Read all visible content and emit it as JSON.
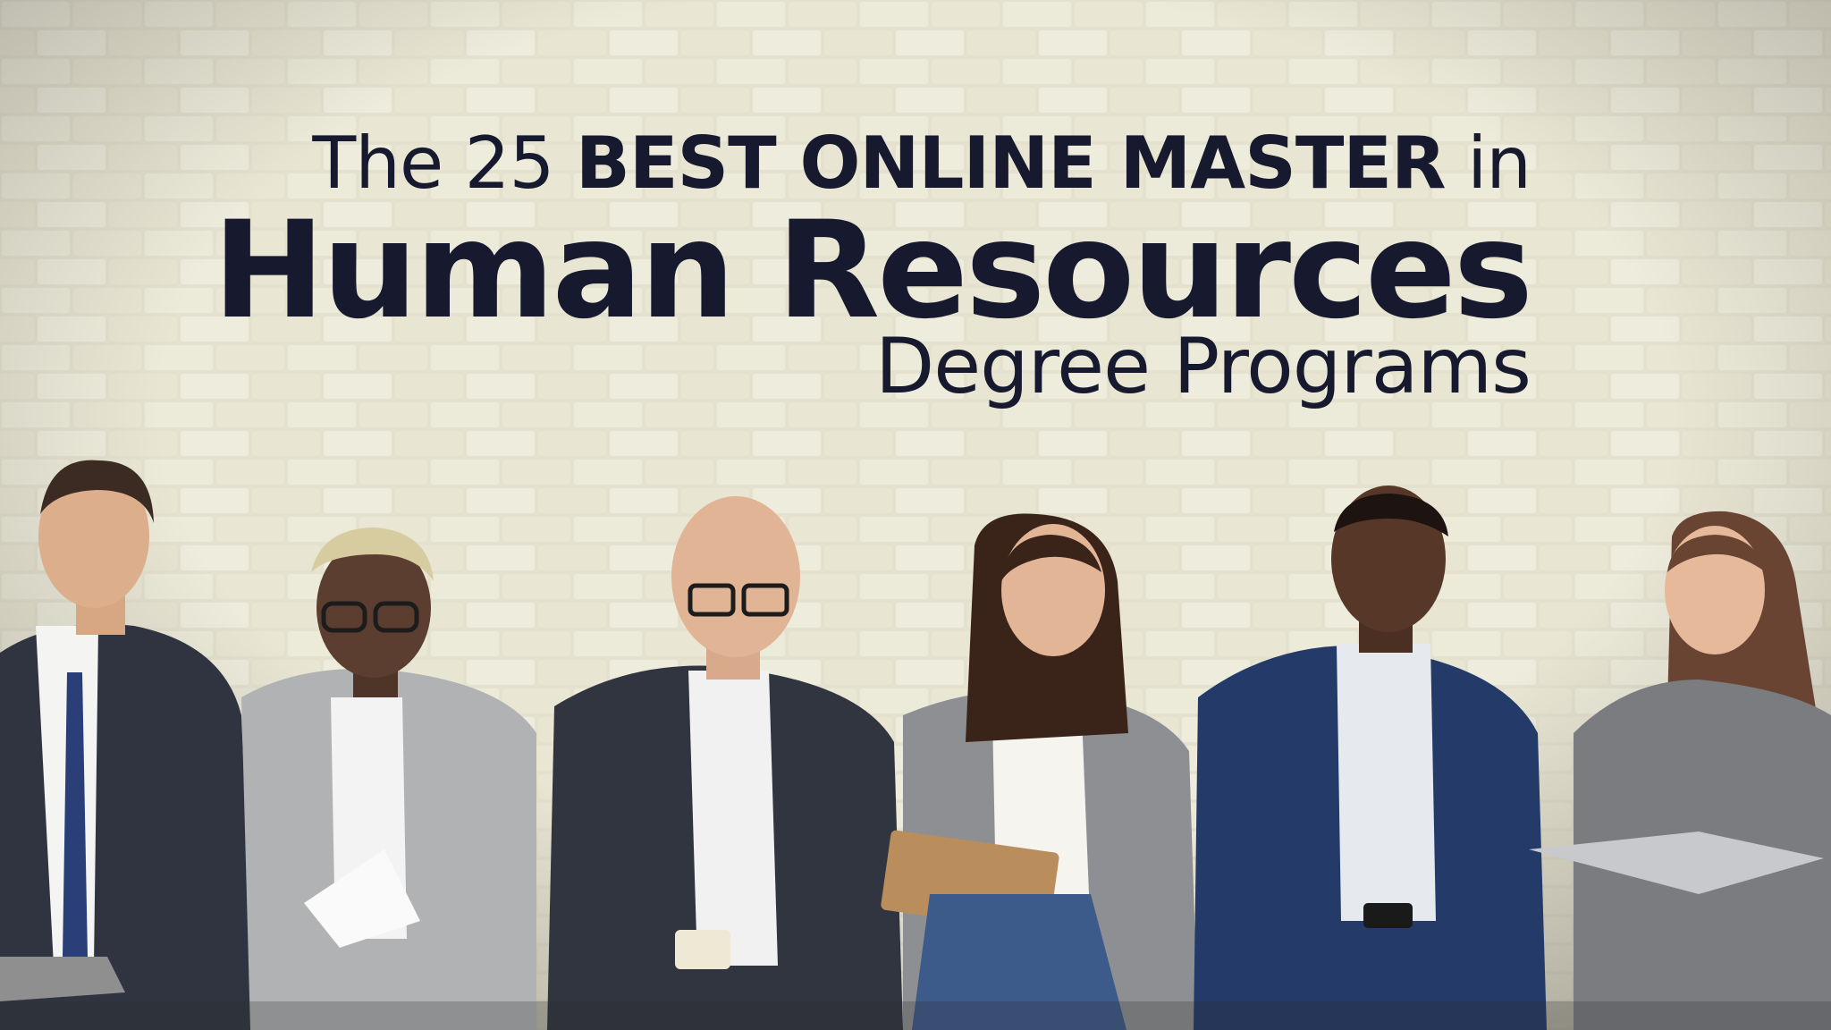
{
  "headline": {
    "line1_prefix": "The 25 ",
    "line1_bold": "BEST ONLINE MASTER",
    "line1_suffix": " in",
    "line2": "Human Resources",
    "line3": "Degree Programs"
  },
  "colors": {
    "wall": "#e6e3d2",
    "mortar": "#c9c6b4",
    "text": "#171a2e",
    "navy_suit": "#243a68",
    "charcoal_suit": "#2f3440",
    "grey_blazer": "#a9aaac"
  }
}
